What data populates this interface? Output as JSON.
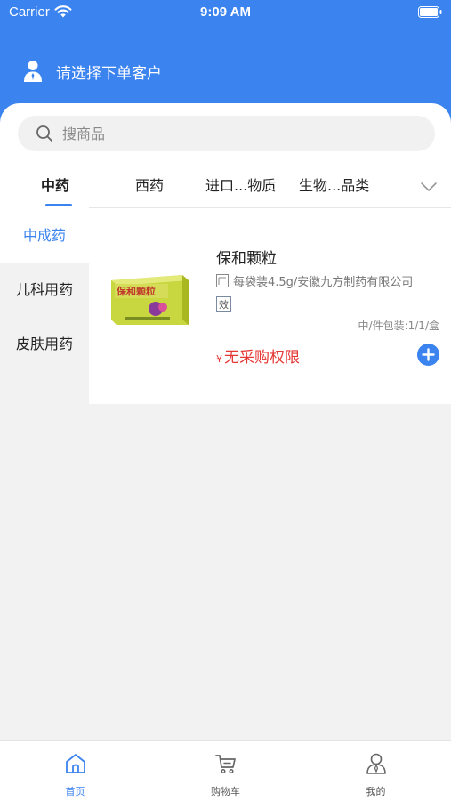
{
  "status_bar": {
    "carrier": "Carrier",
    "time": "9:09 AM"
  },
  "header": {
    "customer_prompt": "请选择下单客户"
  },
  "search": {
    "placeholder": "搜商品"
  },
  "category_tabs": [
    "中药",
    "西药",
    "进口...物质",
    "生物...品类"
  ],
  "active_tab": "中药",
  "sidebar": {
    "items": [
      "中成药",
      "儿科用药",
      "皮肤用药"
    ],
    "active": "中成药"
  },
  "product": {
    "name": "保和颗粒",
    "spec": "每袋装4.5g/安徽九方制药有限公司",
    "efficacy_tag": "效",
    "pack_info": "中/件包装:1/1/盒",
    "currency": "¥",
    "price_text": "无采购权限",
    "image_label": "保和颗粒"
  },
  "tabbar": {
    "items": [
      "首页",
      "购物车",
      "我的"
    ],
    "active": "首页"
  },
  "colors": {
    "accent": "#3b83ef",
    "price_red": "#e53935"
  }
}
